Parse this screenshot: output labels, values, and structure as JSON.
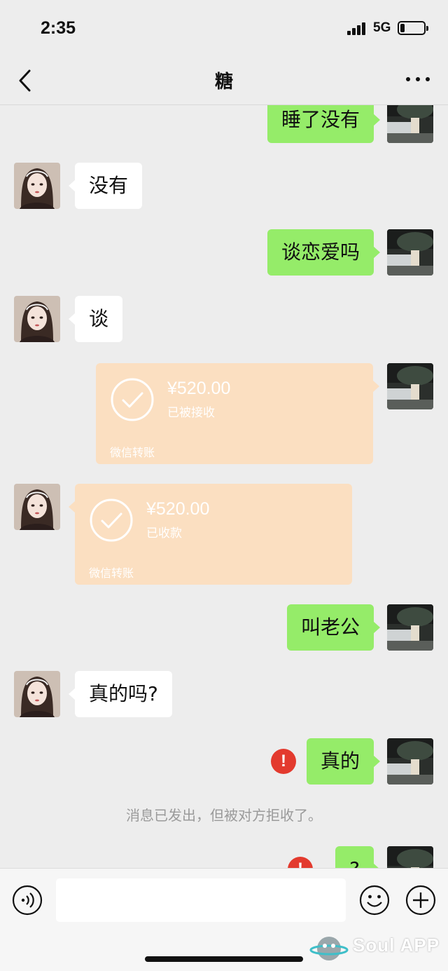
{
  "status_bar": {
    "time": "2:35",
    "network": "5G",
    "battery_level": 0.2
  },
  "nav": {
    "title": "糖"
  },
  "messages": [
    {
      "side": "out",
      "type": "text",
      "text": "睡了没有"
    },
    {
      "side": "in",
      "type": "text",
      "text": "没有"
    },
    {
      "side": "out",
      "type": "text",
      "text": "谈恋爱吗"
    },
    {
      "side": "in",
      "type": "text",
      "text": "谈"
    },
    {
      "side": "out",
      "type": "transfer",
      "amount": "¥520.00",
      "status": "已被接收",
      "brand": "微信转账"
    },
    {
      "side": "in",
      "type": "transfer",
      "amount": "¥520.00",
      "status": "已收款",
      "brand": "微信转账"
    },
    {
      "side": "out",
      "type": "text",
      "text": "叫老公"
    },
    {
      "side": "in",
      "type": "text",
      "text": "真的吗?"
    },
    {
      "side": "out",
      "type": "text",
      "text": "真的",
      "error": true
    },
    {
      "side": "out",
      "type": "text",
      "text": "?",
      "error": true
    }
  ],
  "system_note": "消息已发出，但被对方拒收了。",
  "error_mark": "!",
  "colors": {
    "outgoing_bubble": "#95ec69",
    "incoming_bubble": "#ffffff",
    "transfer_card": "#fbdfc1",
    "error": "#e33a2e",
    "background": "#ededed"
  },
  "icons": {
    "voice": "voice-icon",
    "emoji": "emoji-icon",
    "plus": "plus-icon",
    "back": "back-chevron-icon",
    "more": "more-dots-icon"
  },
  "watermark": {
    "text": "Soul APP"
  }
}
